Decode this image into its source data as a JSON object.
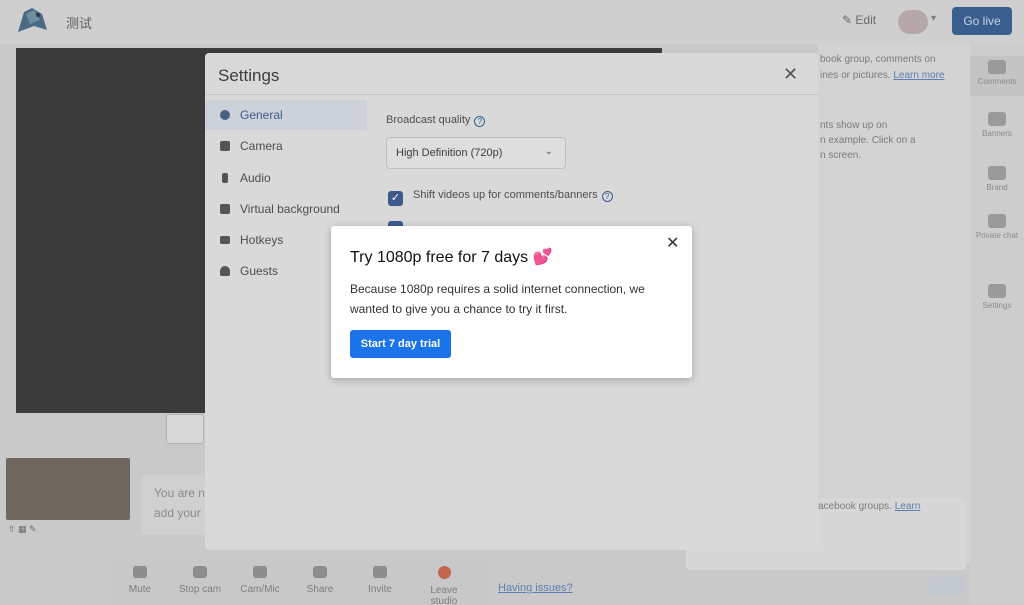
{
  "app": {
    "brand_text": "测试",
    "edit_label": "Edit",
    "go_live_label": "Go live",
    "right_panel": {
      "line1": "book group, comments on",
      "line2": "ines or pictures.",
      "line2_link": "Learn more",
      "line3": "nts show up on",
      "line4": "n example. Click on a",
      "line5": "n screen."
    },
    "rail": [
      "Comments",
      "Banners",
      "Brand",
      "Private chat",
      "Settings"
    ],
    "toolbar": [
      "Mute",
      "Stop cam",
      "Cam/Mic",
      "Share",
      "Invite",
      "Leave studio"
    ],
    "having_issues": "Having issues?",
    "notice_line1": "You are n",
    "notice_line2": "add your",
    "comments_hint": "acebook groups.",
    "comments_hint_link": "Learn"
  },
  "settings": {
    "title": "Settings",
    "nav": [
      {
        "label": "General",
        "icon": "gear-icon",
        "active": true
      },
      {
        "label": "Camera",
        "icon": "camera-icon",
        "active": false
      },
      {
        "label": "Audio",
        "icon": "microphone-icon",
        "active": false
      },
      {
        "label": "Virtual background",
        "icon": "image-icon",
        "active": false
      },
      {
        "label": "Hotkeys",
        "icon": "keyboard-icon",
        "active": false
      },
      {
        "label": "Guests",
        "icon": "person-icon",
        "active": false
      }
    ],
    "broadcast_quality_label": "Broadcast quality",
    "broadcast_quality_value": "High Definition (720p)",
    "shift_videos_label": "Shift videos up for comments/banners",
    "shift_videos_checked": true
  },
  "trial_dialog": {
    "title": "Try 1080p free for 7 days",
    "title_emoji": "💕",
    "body": "Because 1080p requires a solid internet connection, we wanted to give you a chance to try it first.",
    "button": "Start 7 day trial"
  },
  "colors": {
    "primary_button": "#1a73e8",
    "active_nav_text": "#3c5a8c"
  }
}
